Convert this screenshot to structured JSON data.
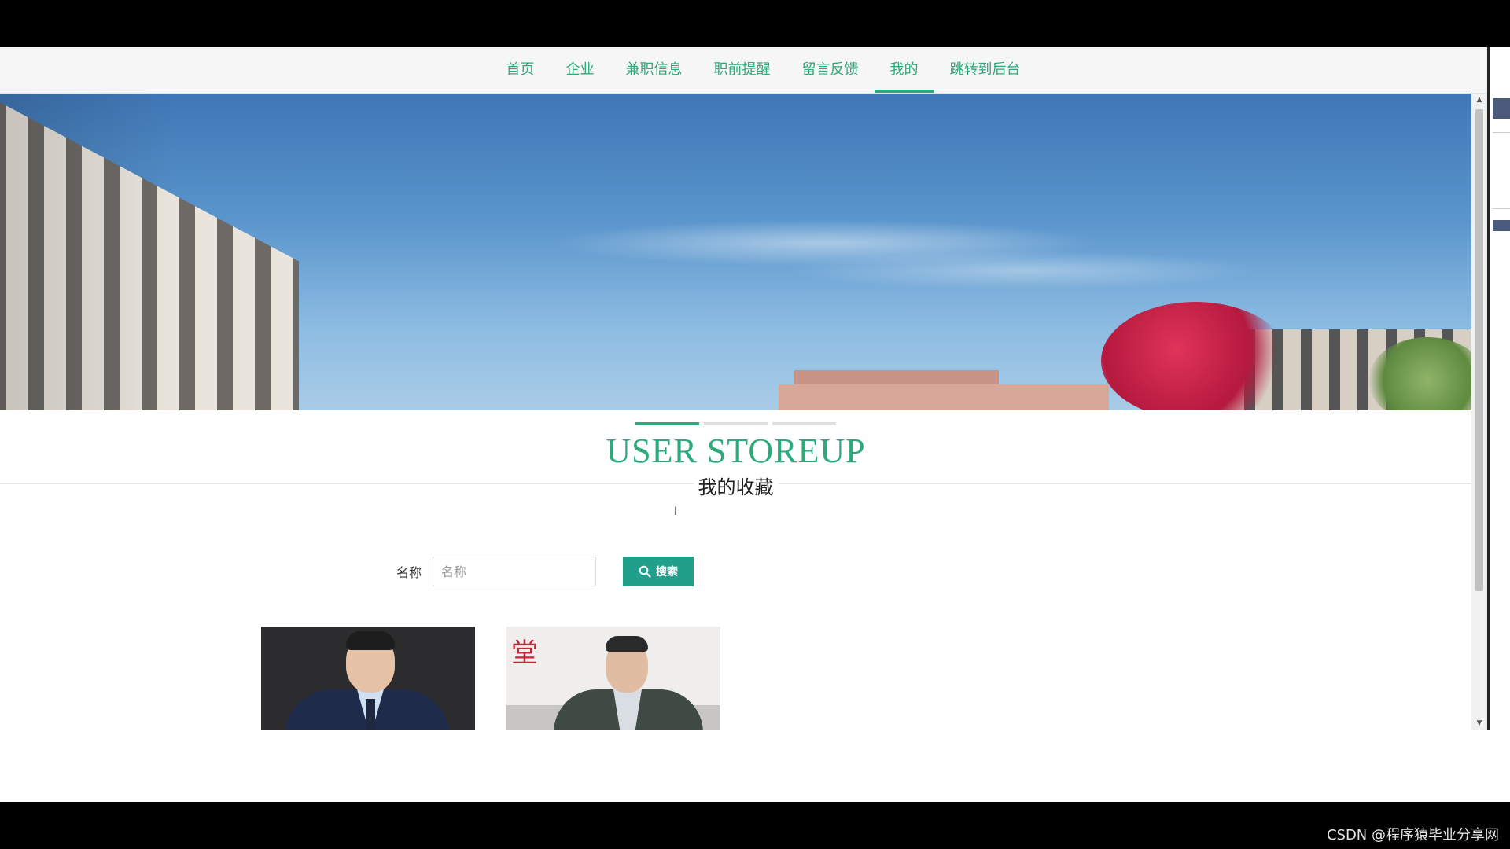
{
  "nav": {
    "items": [
      {
        "label": "首页"
      },
      {
        "label": "企业"
      },
      {
        "label": "兼职信息"
      },
      {
        "label": "职前提醒"
      },
      {
        "label": "留言反馈"
      },
      {
        "label": "我的"
      },
      {
        "label": "跳转到后台"
      }
    ],
    "active_index": 5
  },
  "banner": {
    "slides_total": 3,
    "active_slide": 1
  },
  "section": {
    "title_en": "USER STOREUP",
    "title_cn": "我的收藏"
  },
  "search": {
    "label": "名称",
    "placeholder": "名称",
    "value": "",
    "button_label": "搜索"
  },
  "favorites": [
    {
      "name": "",
      "icon": "person-photo"
    },
    {
      "name": "",
      "icon": "person-photo"
    }
  ],
  "watermark": "CSDN @程序猿毕业分享网",
  "colors": {
    "accent": "#2daa7a",
    "button": "#20a08a",
    "nav_bg": "#f6f6f6"
  }
}
